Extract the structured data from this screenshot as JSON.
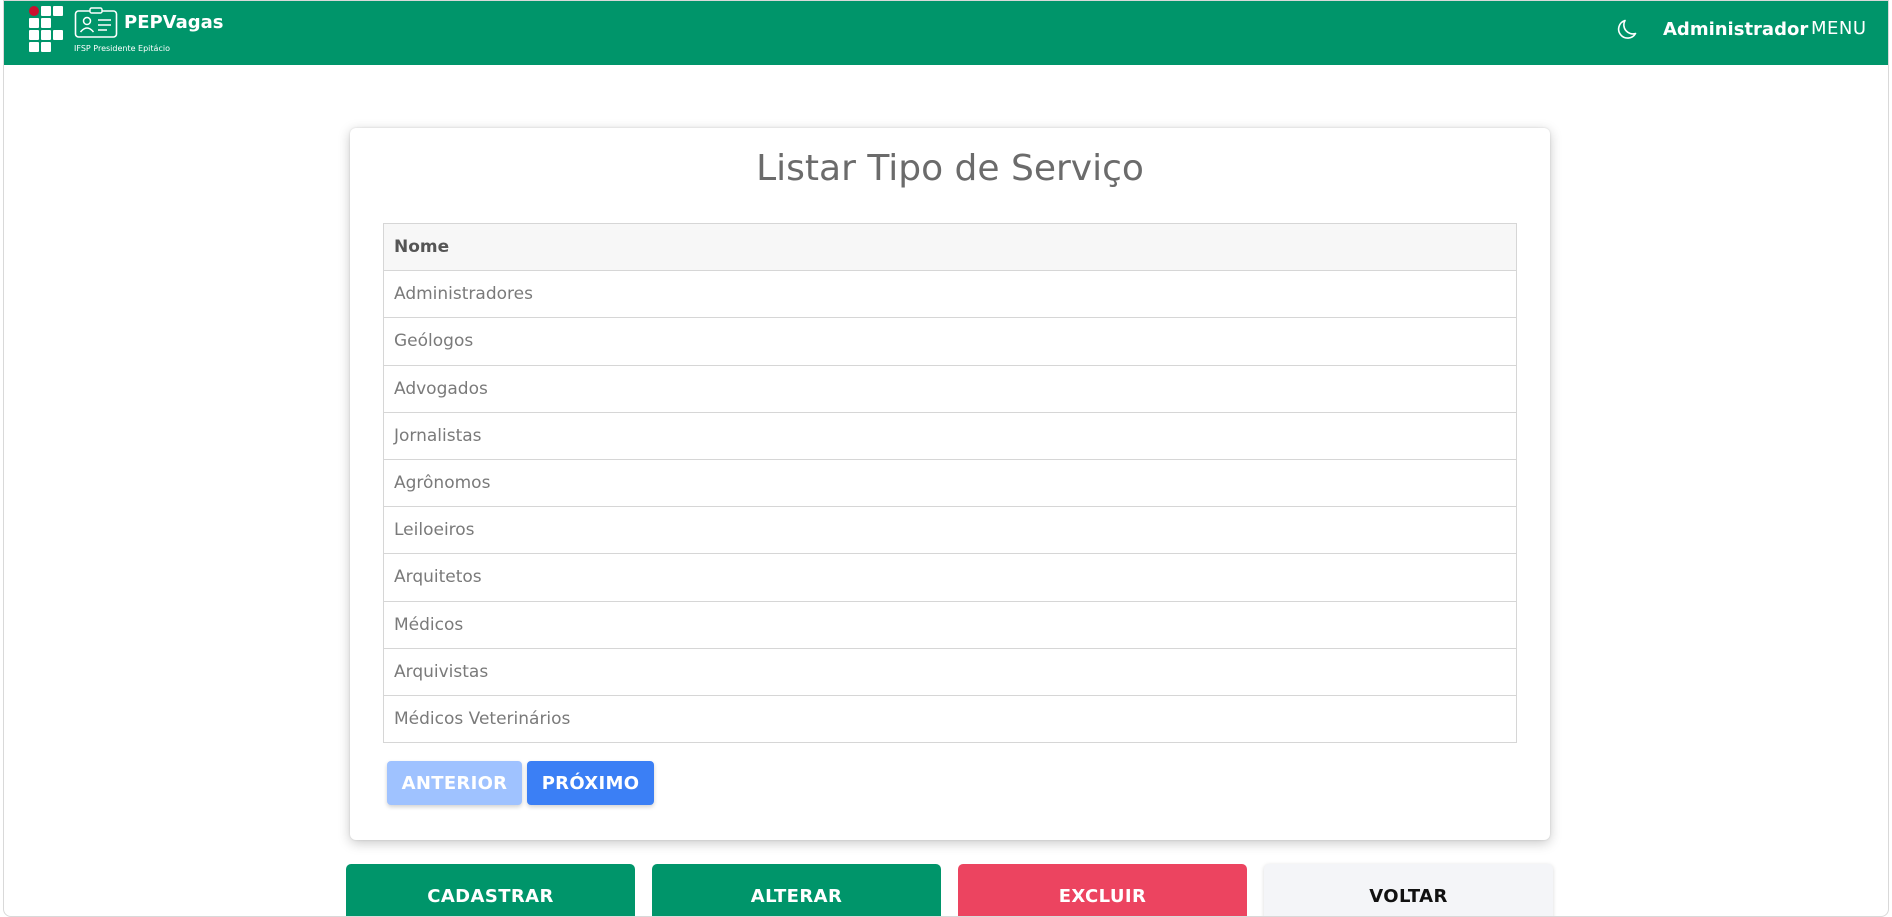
{
  "header": {
    "brand": "PEPVagas",
    "subtitle": "IFSP Presidente Epitácio",
    "user": "Administrador",
    "menu_label": "MENU",
    "color": "#00956a",
    "icons": [
      "ifsp-logo-icon",
      "id-badge-icon",
      "moon-icon"
    ]
  },
  "card": {
    "title": "Listar Tipo de Serviço",
    "columns": [
      "Nome"
    ],
    "rows": [
      "Administradores",
      "Geólogos",
      "Advogados",
      "Jornalistas",
      "Agrônomos",
      "Leiloeiros",
      "Arquitetos",
      "Médicos",
      "Arquivistas",
      "Médicos Veterinários"
    ],
    "pagination": {
      "prev_label": "ANTERIOR",
      "next_label": "PRÓXIMO",
      "prev_disabled": true
    }
  },
  "actions": {
    "create": "CADASTRAR",
    "edit": "ALTERAR",
    "delete": "EXCLUIR",
    "back": "VOLTAR",
    "colors": {
      "primary": "#00956a",
      "danger": "#ec4460",
      "neutral": "#f4f5f8"
    }
  }
}
